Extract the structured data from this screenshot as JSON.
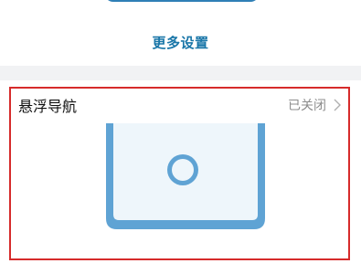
{
  "top_section": {
    "more_settings_label": "更多设置"
  },
  "floating_nav": {
    "title": "悬浮导航",
    "status": "已关闭",
    "chevron_icon": "chevron-right-icon",
    "illustration_icon": "phone-floating-button-illustration"
  },
  "colors": {
    "accent": "#1976a8",
    "highlight_border": "#d62b2b",
    "phone_blue": "#5fa3d4",
    "phone_screen": "#eef6fb",
    "separator": "#f1f2f4"
  }
}
